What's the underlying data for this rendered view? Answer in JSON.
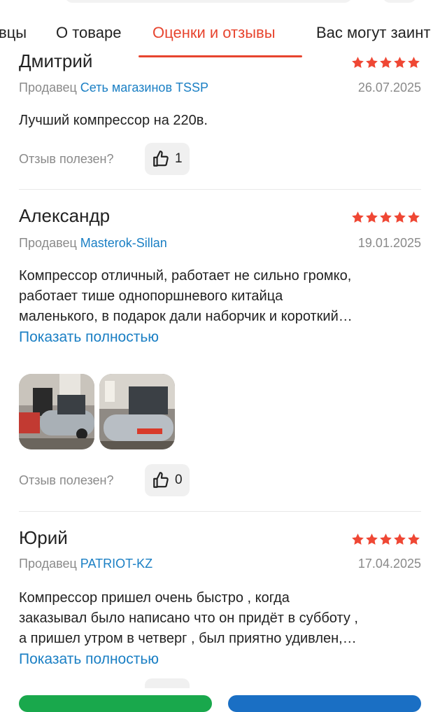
{
  "tabs": {
    "items": [
      "вцы",
      "О товаре",
      "Оценки и отзывы",
      "Вас могут заинт"
    ],
    "active_index": 2
  },
  "reviews": [
    {
      "name": "Дмитрий",
      "rating": 5,
      "seller_prefix": "Продавец",
      "seller_shop": "Сеть магазинов TSSP",
      "date": "26.07.2025",
      "text": "Лучший компрессор на 220в.",
      "helpful_label": "Отзыв полезен?",
      "likes": "1"
    },
    {
      "name": "Александр",
      "rating": 5,
      "seller_prefix": "Продавец",
      "seller_shop": "Masterok-Sillan",
      "date": "19.01.2025",
      "text_lines": [
        "Компрессор отличный, работает не сильно громко,",
        "работает тише однопоршневого китайца",
        "маленького, в подарок дали наборчик и короткий…"
      ],
      "show_more": "Показать полностью",
      "helpful_label": "Отзыв полезен?",
      "likes": "0"
    },
    {
      "name": "Юрий",
      "rating": 5,
      "seller_prefix": "Продавец",
      "seller_shop": "PATRIOT-KZ",
      "date": "17.04.2025",
      "text_lines": [
        "Компрессор пришел очень быстро , когда",
        "заказывал было написано что он придёт в субботу ,",
        "а пришел утром в четверг , был приятно удивлен,…"
      ],
      "show_more": "Показать полностью"
    }
  ],
  "colors": {
    "accent": "#e7452f",
    "link": "#1a7fc4",
    "muted": "#8a8a8a",
    "star": "#ef4734",
    "green_button": "#19a84c",
    "blue_button": "#1a6fc4"
  }
}
